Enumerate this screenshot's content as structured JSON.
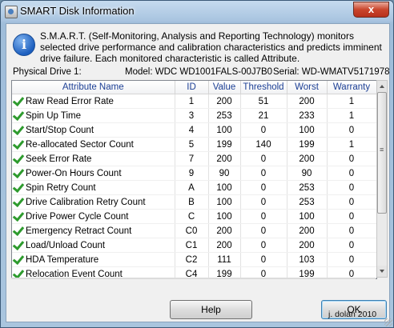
{
  "window": {
    "title": "SMART Disk Information",
    "close_glyph": "x",
    "description": "S.M.A.R.T. (Self-Monitoring, Analysis and Reporting Technology) monitors selected drive performance and calibration characteristics and predicts imminent drive failure. Each monitored characteristic is called Attribute.",
    "info_glyph": "i"
  },
  "drive": {
    "label": "Physical Drive 1:",
    "model": "Model: WDC WD1001FALS-00J7B0",
    "serial": "Serial: WD-WMATV5171978"
  },
  "table": {
    "headers": {
      "name": "Attribute Name",
      "id": "ID",
      "value": "Value",
      "threshold": "Threshold",
      "worst": "Worst",
      "warranty": "Warranty"
    },
    "rows": [
      {
        "name": "Raw Read Error Rate",
        "id": "1",
        "value": "200",
        "threshold": "51",
        "worst": "200",
        "warranty": "1"
      },
      {
        "name": "Spin Up Time",
        "id": "3",
        "value": "253",
        "threshold": "21",
        "worst": "233",
        "warranty": "1"
      },
      {
        "name": "Start/Stop Count",
        "id": "4",
        "value": "100",
        "threshold": "0",
        "worst": "100",
        "warranty": "0"
      },
      {
        "name": "Re-allocated Sector Count",
        "id": "5",
        "value": "199",
        "threshold": "140",
        "worst": "199",
        "warranty": "1"
      },
      {
        "name": "Seek Error Rate",
        "id": "7",
        "value": "200",
        "threshold": "0",
        "worst": "200",
        "warranty": "0"
      },
      {
        "name": "Power-On Hours Count",
        "id": "9",
        "value": "90",
        "threshold": "0",
        "worst": "90",
        "warranty": "0"
      },
      {
        "name": "Spin Retry Count",
        "id": "A",
        "value": "100",
        "threshold": "0",
        "worst": "253",
        "warranty": "0"
      },
      {
        "name": "Drive Calibration Retry Count",
        "id": "B",
        "value": "100",
        "threshold": "0",
        "worst": "253",
        "warranty": "0"
      },
      {
        "name": "Drive Power Cycle Count",
        "id": "C",
        "value": "100",
        "threshold": "0",
        "worst": "100",
        "warranty": "0"
      },
      {
        "name": "Emergency Retract Count",
        "id": "C0",
        "value": "200",
        "threshold": "0",
        "worst": "200",
        "warranty": "0"
      },
      {
        "name": "Load/Unload Count",
        "id": "C1",
        "value": "200",
        "threshold": "0",
        "worst": "200",
        "warranty": "0"
      },
      {
        "name": "HDA Temperature",
        "id": "C2",
        "value": "111",
        "threshold": "0",
        "worst": "103",
        "warranty": "0"
      },
      {
        "name": "Relocation Event Count",
        "id": "C4",
        "value": "199",
        "threshold": "0",
        "worst": "199",
        "warranty": "0"
      }
    ]
  },
  "buttons": {
    "help": "Help",
    "ok": "OK"
  },
  "watermark": "j. dolan 2010",
  "colors": {
    "header_text": "#1c3f95",
    "check": "#2e9b2e",
    "close": "#c9452c"
  }
}
